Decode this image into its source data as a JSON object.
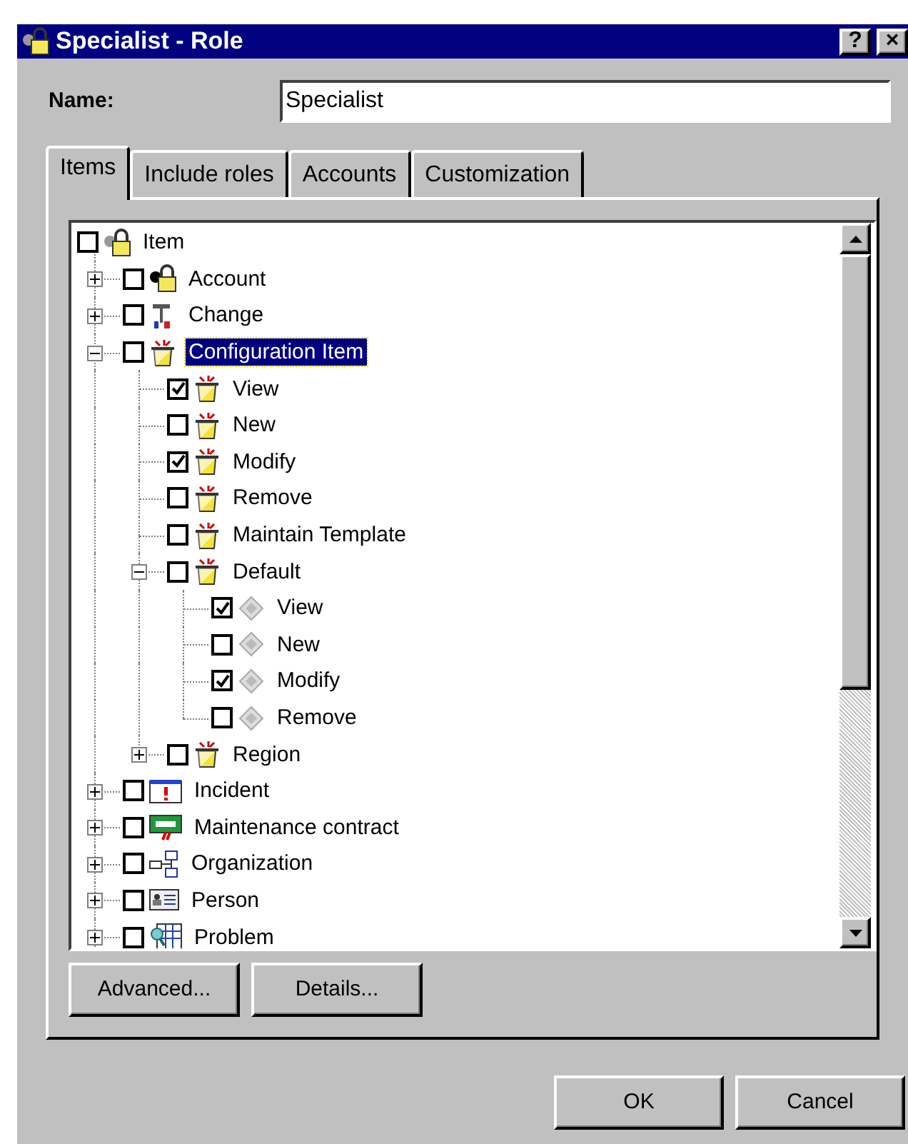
{
  "window": {
    "title": "Specialist - Role",
    "buttons": [
      "?",
      "×"
    ]
  },
  "name_field": {
    "label": "Name:",
    "value": "Specialist"
  },
  "tabs": [
    {
      "label": "Items",
      "selected": true
    },
    {
      "label": "Include roles",
      "selected": false
    },
    {
      "label": "Accounts",
      "selected": false
    },
    {
      "label": "Customization",
      "selected": false
    }
  ],
  "tree": [
    {
      "label": "Item",
      "kind": "lock",
      "checked": false,
      "selected": false,
      "children": [
        {
          "label": "Account",
          "kind": "account",
          "checked": false,
          "selected": false,
          "expanded": false
        },
        {
          "label": "Change",
          "kind": "change",
          "checked": false,
          "selected": false,
          "expanded": false
        },
        {
          "label": "Configuration Item",
          "kind": "bin",
          "checked": false,
          "selected": true,
          "expanded": true,
          "children": [
            {
              "label": "View",
              "kind": "bin",
              "checked": true,
              "selected": false
            },
            {
              "label": "New",
              "kind": "bin",
              "checked": false,
              "selected": false
            },
            {
              "label": "Modify",
              "kind": "bin",
              "checked": true,
              "selected": false
            },
            {
              "label": "Remove",
              "kind": "bin",
              "checked": false,
              "selected": false
            },
            {
              "label": "Maintain Template",
              "kind": "bin",
              "checked": false,
              "selected": false
            },
            {
              "label": "Default",
              "kind": "bin",
              "checked": false,
              "selected": false,
              "expanded": true,
              "children": [
                {
                  "label": "View",
                  "kind": "diamond",
                  "checked": true,
                  "selected": false
                },
                {
                  "label": "New",
                  "kind": "diamond",
                  "checked": false,
                  "selected": false
                },
                {
                  "label": "Modify",
                  "kind": "diamond",
                  "checked": true,
                  "selected": false
                },
                {
                  "label": "Remove",
                  "kind": "diamond",
                  "checked": false,
                  "selected": false
                }
              ]
            },
            {
              "label": "Region",
              "kind": "bin",
              "checked": false,
              "selected": false,
              "expanded": false
            }
          ]
        },
        {
          "label": "Incident",
          "kind": "incident",
          "checked": false,
          "selected": false,
          "expanded": false
        },
        {
          "label": "Maintenance contract",
          "kind": "contract",
          "checked": false,
          "selected": false,
          "expanded": false
        },
        {
          "label": "Organization",
          "kind": "org",
          "checked": false,
          "selected": false,
          "expanded": false
        },
        {
          "label": "Person",
          "kind": "person",
          "checked": false,
          "selected": false,
          "expanded": false
        },
        {
          "label": "Problem",
          "kind": "problem",
          "checked": false,
          "selected": false,
          "expanded": false
        }
      ]
    }
  ],
  "panel_buttons": [
    "Advanced...",
    "Details..."
  ],
  "dialog_buttons": [
    "OK",
    "Cancel"
  ]
}
